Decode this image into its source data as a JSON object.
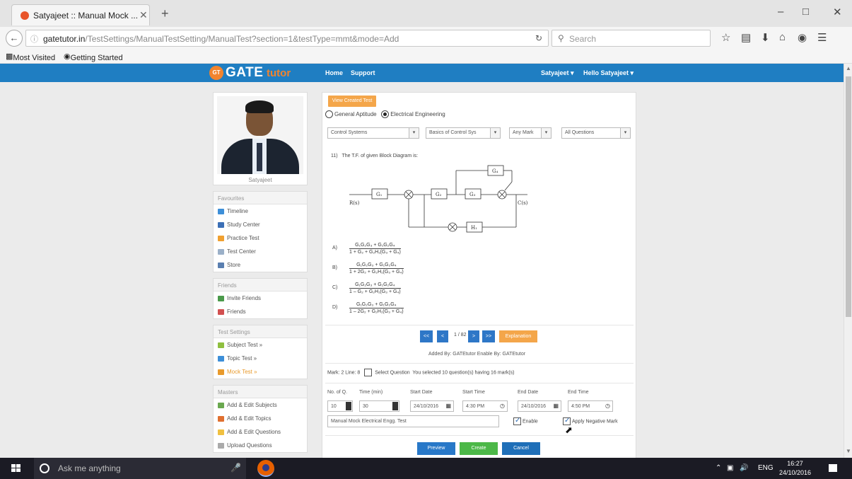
{
  "browser": {
    "tab_title": "Satyajeet :: Manual Mock ...",
    "tab_close": "✕",
    "new_tab": "+",
    "url_domain": "gatetutor.in",
    "url_path": "/TestSettings/ManualTestSetting/ManualTest?section=1&testType=mmt&mode=Add",
    "search_placeholder": "Search",
    "bookmarks": [
      "Most Visited",
      "Getting Started"
    ],
    "win_controls": [
      "–",
      "□",
      "✕"
    ]
  },
  "site": {
    "logo_badge": "GT",
    "logo_gate": "GATE",
    "logo_tutor": "tutor",
    "nav": [
      "Home",
      "Support"
    ],
    "user_menu": [
      "Satyajeet ▾",
      "Hello Satyajeet ▾"
    ]
  },
  "sidebar": {
    "profile_name": "Satyajeet",
    "favourites_title": "Favourites",
    "favourites": [
      "Timeline",
      "Study Center",
      "Practice Test",
      "Test Center",
      "Store"
    ],
    "friends_title": "Friends",
    "friends": [
      "Invite Friends",
      "Friends"
    ],
    "test_settings_title": "Test Settings",
    "test_settings": [
      "Subject Test »",
      "Topic Test »",
      "Mock Test »"
    ],
    "masters_title": "Masters",
    "masters": [
      "Add & Edit Subjects",
      "Add & Edit Topics",
      "Add & Edit Questions",
      "Upload Questions"
    ]
  },
  "main": {
    "view_button": "View Created Test",
    "radio_general": "General Aptitude",
    "radio_electrical": "Electrical Engineering",
    "select_subject": "Control Systems",
    "select_topic": "Basics of Control Sys",
    "select_mark": "Any Mark",
    "select_questions": "All Questions",
    "question_number": "11)",
    "question_text": "The T.F. of given Block Diagram is:",
    "diagram_labels": {
      "input": "R(s)",
      "output": "C(s)",
      "g1": "G₁",
      "g2": "G₂",
      "g3": "G₃",
      "g4": "G₄",
      "h1": "H₁"
    },
    "options": [
      {
        "label": "A)",
        "num": "G₁G₂G₃ + G₁G₂G₄",
        "den": "1 + G₂ + G₂H₁(G₃ + G₄)"
      },
      {
        "label": "B)",
        "num": "G₁G₂G₃ + G₁G₂G₄",
        "den": "1 + 2G₂ + G₂H₁(G₃ + G₄)"
      },
      {
        "label": "C)",
        "num": "G₁G₂G₃ + G₁G₂G₄",
        "den": "1 – G₂ + G₂H₁(G₃ + G₄)"
      },
      {
        "label": "D)",
        "num": "G₁G₂G₃ + G₁G₂G₄",
        "den": "1 – 2G₂ + G₂H₁(G₃ + G₄)"
      }
    ],
    "pager": {
      "first": "<<",
      "prev": "<",
      "status": "1 / 82",
      "next": ">",
      "last": ">>",
      "explanation": "Explanation"
    },
    "added_by": "Added By: GATEtutor   Enable By: GATEtutor",
    "mark_text": "Mark: 2   Line: 8",
    "select_question_label": "Select Question",
    "selected_text": "You selected 10 question(s) having 16 mark(s)",
    "fields": {
      "no_of_q_label": "No. of Q.",
      "no_of_q": "10",
      "time_label": "Time (min)",
      "time": "30",
      "start_date_label": "Start Date",
      "start_date": "24/10/2016",
      "start_time_label": "Start Time",
      "start_time": "4:30 PM",
      "end_date_label": "End Date",
      "end_date": "24/10/2016",
      "end_time_label": "End Time",
      "end_time": "4:50 PM"
    },
    "test_name": "Manual Mock Electrical Engg. Test",
    "enable_label": "Enable",
    "negative_label": "Apply Negative Mark",
    "buttons": {
      "preview": "Preview",
      "create": "Create",
      "cancel": "Cancel"
    }
  },
  "taskbar": {
    "search_text": "Ask me anything",
    "tray_lang": "ENG",
    "time": "16:27",
    "date": "24/10/2016"
  },
  "colors": {
    "header_blue": "#1f7ec2",
    "accent_orange": "#f4a64a",
    "pager_blue": "#2e77c7",
    "create_green": "#4cb848",
    "preview_blue": "#2878c8"
  }
}
